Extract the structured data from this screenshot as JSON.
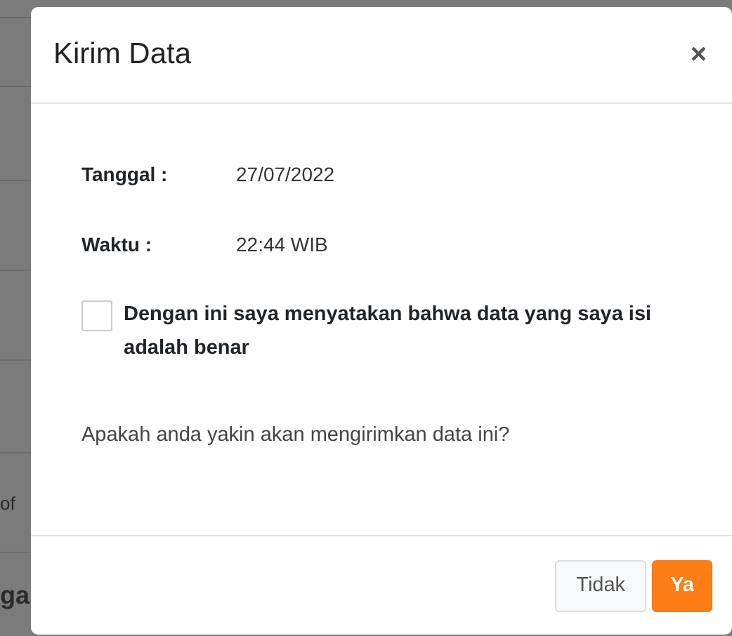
{
  "background": {
    "fragments": [
      {
        "text": "of",
        "kind": "text"
      },
      {
        "text": "ga",
        "kind": "heading"
      }
    ]
  },
  "modal": {
    "title": "Kirim Data",
    "close": "×",
    "fields": [
      {
        "label": "Tanggal :",
        "value": "27/07/2022"
      },
      {
        "label": "Waktu :",
        "value": "22:44 WIB"
      }
    ],
    "agreement": {
      "label": "Dengan ini saya menyatakan bahwa data yang saya isi adalah benar",
      "checked": false
    },
    "question": "Apakah anda yakin akan mengirimkan data ini?",
    "buttons": [
      {
        "label": "Tidak",
        "kind": "secondary"
      },
      {
        "label": "Ya",
        "kind": "primary"
      }
    ]
  }
}
